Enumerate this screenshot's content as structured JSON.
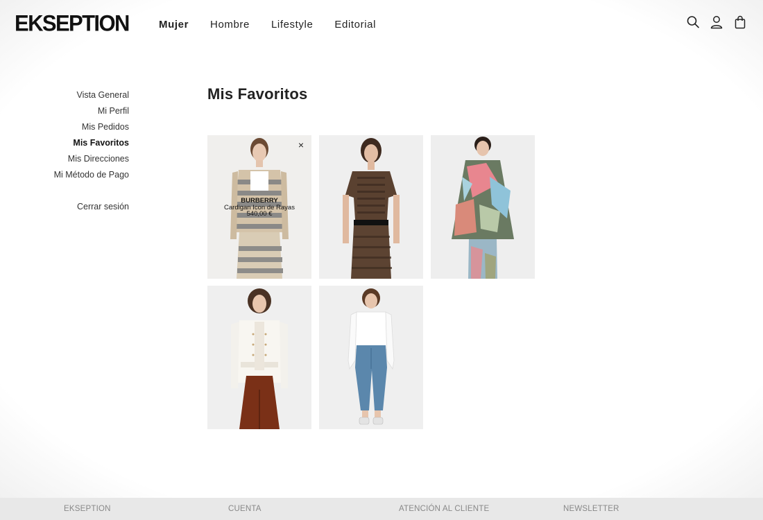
{
  "header": {
    "logo": "EKSEPTION",
    "nav": [
      {
        "label": "Mujer",
        "active": true
      },
      {
        "label": "Hombre",
        "active": false
      },
      {
        "label": "Lifestyle",
        "active": false
      },
      {
        "label": "Editorial",
        "active": false
      }
    ],
    "icons": [
      "search-icon",
      "user-icon",
      "bag-icon"
    ]
  },
  "sidebar": {
    "items": [
      {
        "label": "Vista General",
        "active": false
      },
      {
        "label": "Mi Perfil",
        "active": false
      },
      {
        "label": "Mis Pedidos",
        "active": false
      },
      {
        "label": "Mis Favoritos",
        "active": true
      },
      {
        "label": "Mis Direcciones",
        "active": false
      },
      {
        "label": "Mi Método de Pago",
        "active": false
      }
    ],
    "logout": "Cerrar sesión"
  },
  "main": {
    "title": "Mis Favoritos",
    "products": [
      {
        "brand": "BURBERRY",
        "name": "Cardigan Icon de Rayas",
        "price": "540,00 €",
        "hovered": true,
        "close_glyph": "×"
      },
      {
        "brand": "",
        "name": "",
        "price": "",
        "hovered": false
      },
      {
        "brand": "",
        "name": "",
        "price": "",
        "hovered": false
      },
      {
        "brand": "",
        "name": "",
        "price": "",
        "hovered": false
      },
      {
        "brand": "",
        "name": "",
        "price": "",
        "hovered": false
      }
    ]
  },
  "footer": {
    "columns": [
      "EKSEPTION",
      "CUENTA",
      "ATENCIÓN AL CLIENTE",
      "NEWSLETTER"
    ]
  },
  "colors": {
    "text": "#222222",
    "card_bg": "#efefef",
    "footer_bg": "#e8e8e8",
    "footer_text": "#888888"
  }
}
